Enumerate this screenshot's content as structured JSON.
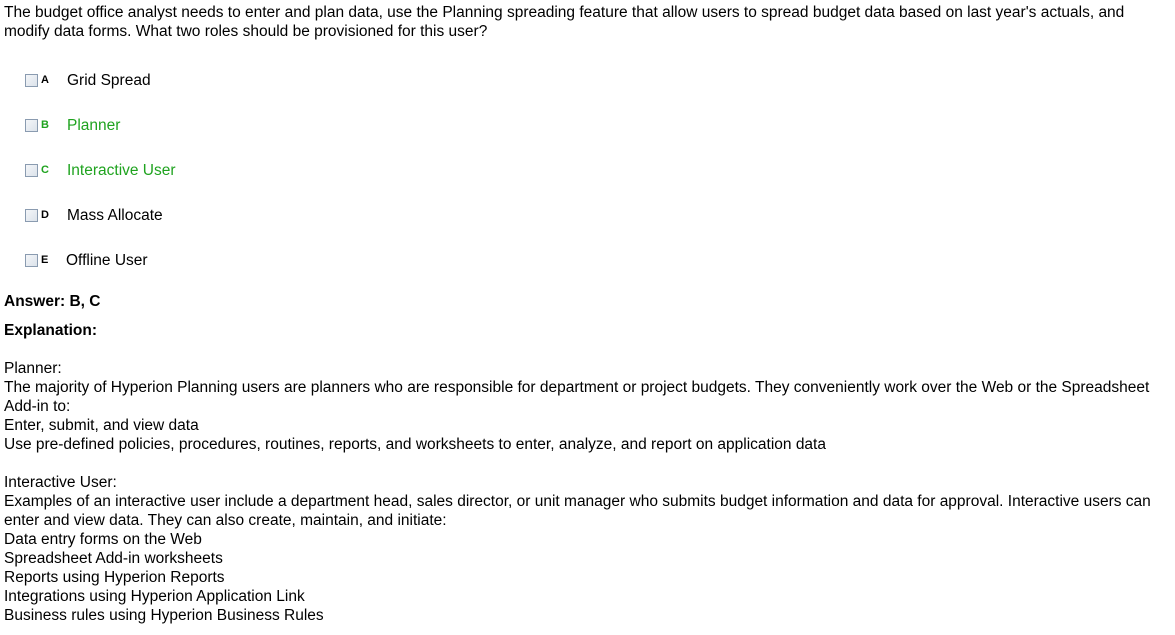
{
  "question": "The budget office analyst needs to enter and plan data, use the Planning spreading feature that allow users to spread budget data based on last year's actuals, and modify data forms. What two roles should be provisioned for this user?",
  "options": [
    {
      "letter": "A",
      "text": "Grid Spread",
      "correct": false
    },
    {
      "letter": "B",
      "text": "Planner",
      "correct": true
    },
    {
      "letter": "C",
      "text": "Interactive User",
      "correct": true
    },
    {
      "letter": "D",
      "text": "Mass Allocate",
      "correct": false
    },
    {
      "letter": "E",
      "text": "Offline User",
      "correct": false
    }
  ],
  "answer": "Answer: B, C",
  "explanation_heading": "Explanation:",
  "explanation": {
    "planner_heading": "Planner:",
    "planner_text": "The majority of Hyperion Planning users are planners who are responsible for department or project budgets. They conveniently work over the Web or the Spreadsheet Add-in to:",
    "planner_item_1": "Enter, submit, and view data",
    "planner_item_2": "Use pre-defined policies, procedures, routines, reports, and worksheets to enter, analyze, and report on application data",
    "interactive_heading": "Interactive User:",
    "interactive_text": "Examples of an interactive user include a department head, sales director, or unit manager who submits budget information and data for approval. Interactive users can enter and view data. They can also create, maintain, and initiate:",
    "interactive_item_1": "Data entry forms on the Web",
    "interactive_item_2": "Spreadsheet Add-in worksheets",
    "interactive_item_3": "Reports using Hyperion Reports",
    "interactive_item_4": "Integrations using Hyperion Application Link",
    "interactive_item_5": "Business rules using Hyperion Business Rules"
  },
  "colors": {
    "correct": "#1fa31f",
    "text": "#000000",
    "checkbox_border": "#8a9bb0"
  }
}
